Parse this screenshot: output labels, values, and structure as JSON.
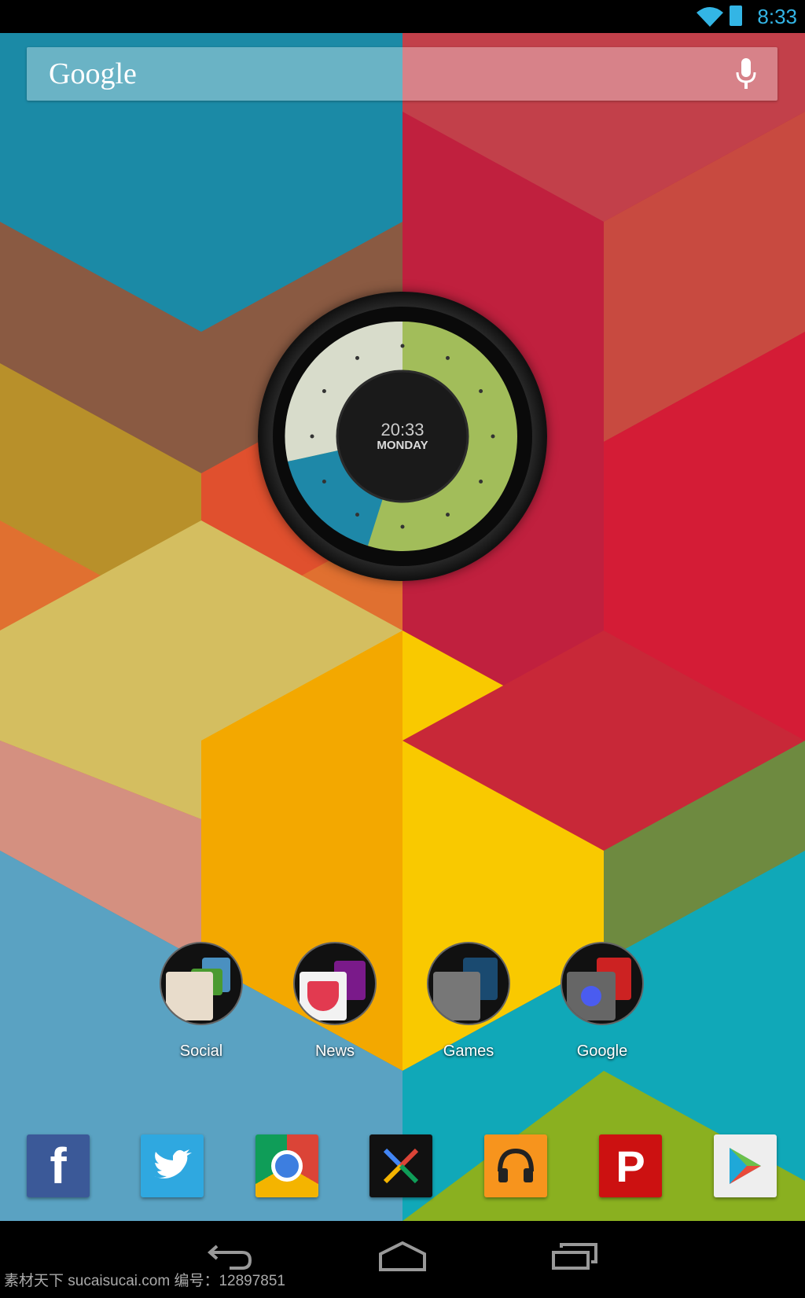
{
  "status_bar": {
    "time": "8:33",
    "icons": [
      "wifi-icon",
      "battery-charging-icon"
    ],
    "accent": "#33b5e5"
  },
  "search": {
    "logo": "Google",
    "icon": "microphone-icon"
  },
  "clock_widget": {
    "time": "20:33",
    "day": "MONDAY"
  },
  "folders": [
    {
      "label": "Social"
    },
    {
      "label": "News"
    },
    {
      "label": "Games"
    },
    {
      "label": "Google"
    }
  ],
  "dock": [
    {
      "name": "Facebook",
      "glyph": "f",
      "color": "#3b5998"
    },
    {
      "name": "Twitter",
      "glyph": "twitter-bird",
      "color": "#2fa8e0"
    },
    {
      "name": "Chrome",
      "glyph": "chrome",
      "color": "#db4437"
    },
    {
      "name": "Nexus",
      "glyph": "x",
      "color": "#111111"
    },
    {
      "name": "Play Music",
      "glyph": "headphones",
      "color": "#f7941d"
    },
    {
      "name": "Pinterest",
      "glyph": "P",
      "color": "#cc1111"
    },
    {
      "name": "Play Store",
      "glyph": "play",
      "color": "#eeeeee"
    }
  ],
  "nav_bar": {
    "buttons": [
      "back",
      "home",
      "recents"
    ]
  },
  "watermark": "素材天下 sucaisucai.com  编号：12897851"
}
